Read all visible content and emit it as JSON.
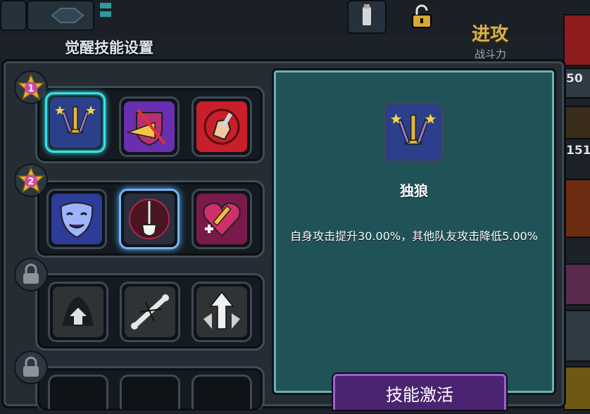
{
  "header": {
    "panel_title": "觉醒技能设置",
    "attack_label": "进攻",
    "power_label": "战斗力"
  },
  "side_stats": [
    "50",
    "151"
  ],
  "tiers": [
    {
      "badge": "1",
      "locked": false,
      "skills": [
        {
          "icon": "wolf-swords-icon",
          "selected": true
        },
        {
          "icon": "shield-slash-icon",
          "selected": false
        },
        {
          "icon": "fist-hammer-icon",
          "selected": false
        }
      ]
    },
    {
      "badge": "2",
      "locked": false,
      "skills": [
        {
          "icon": "theater-mask-icon",
          "selected": false
        },
        {
          "icon": "shovel-icon",
          "selected": false
        },
        {
          "icon": "heart-sword-icon",
          "selected": false
        }
      ]
    },
    {
      "badge": "",
      "locked": true,
      "skills": [
        {
          "icon": "arrow-up-icon",
          "selected": false
        },
        {
          "icon": "broken-bone-icon",
          "selected": false
        },
        {
          "icon": "rising-arrows-icon",
          "selected": false
        }
      ]
    },
    {
      "badge": "",
      "locked": true,
      "skills": []
    }
  ],
  "detail": {
    "icon": "wolf-swords-icon",
    "name": "独狼",
    "description": "自身攻击提升30.00%，其他队友攻击降低5.00%"
  },
  "activate_button": "技能激活",
  "colors": {
    "panel_bg": "#252c33",
    "detail_bg": "#1f5358",
    "selected_border": "#39e1e6",
    "button_bg": "#4a2470",
    "badge_gold": "#e7b630",
    "badge_pink": "#d04a9e"
  }
}
